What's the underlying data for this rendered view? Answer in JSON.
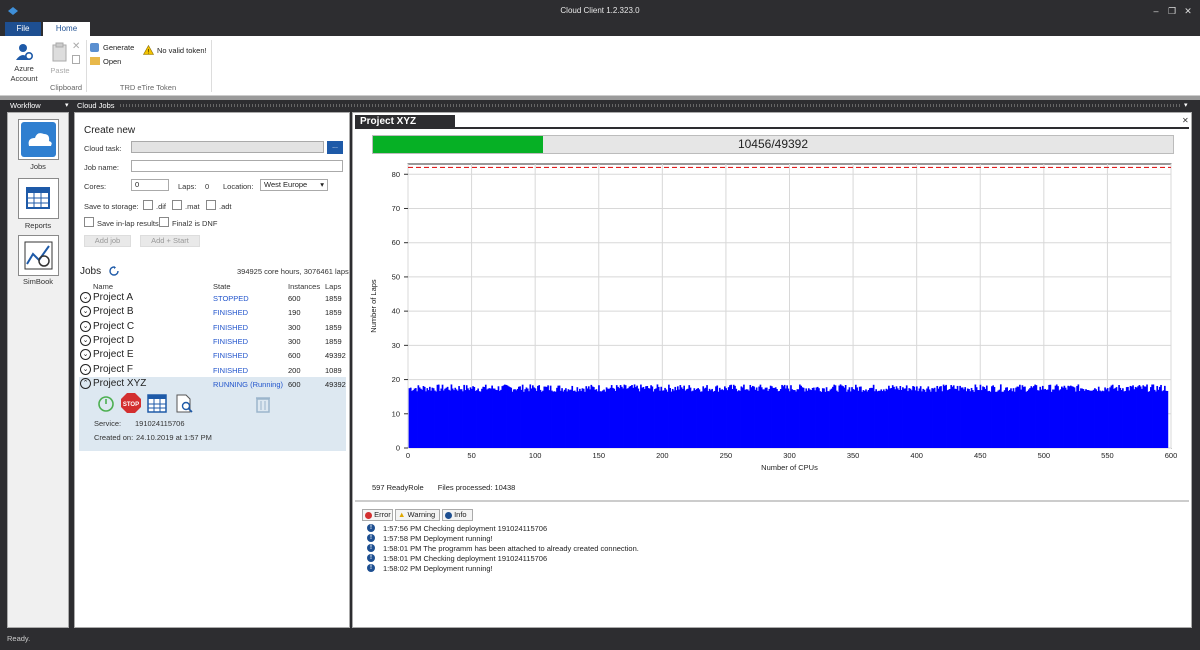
{
  "window": {
    "title": "Cloud Client 1.2.323.0"
  },
  "ribbon": {
    "tabs": [
      "File",
      "Home"
    ],
    "azure_account": "Azure Account",
    "paste": "Paste",
    "clipboard_group": "Clipboard",
    "generate": "Generate",
    "open": "Open",
    "token_warning": "No valid token!",
    "token_group": "TRD eTire Token"
  },
  "workflow": {
    "title": "Workflow",
    "items": [
      {
        "label": "Jobs"
      },
      {
        "label": "Reports"
      },
      {
        "label": "SimBook"
      }
    ]
  },
  "cloud_jobs": {
    "title": "Cloud Jobs",
    "create_new": "Create new",
    "cloud_task_label": "Cloud task:",
    "browse_label": "...",
    "job_name_label": "Job name:",
    "cores_label": "Cores:",
    "cores_value": "0",
    "laps_label": "Laps:",
    "laps_value": "0",
    "location_label": "Location:",
    "location_value": "West Europe",
    "save_label": "Save to storage:",
    "dif": ".dif",
    "mat": ".mat",
    "adt": ".adt",
    "save_inlap": "Save in-lap results",
    "final2": "Final2 is DNF",
    "add_job": "Add job",
    "add_start": "Add + Start",
    "jobs_title": "Jobs",
    "summary": "394925 core hours, 3076461 laps",
    "columns": [
      "Name",
      "State",
      "Instances",
      "Laps"
    ],
    "rows": [
      {
        "name": "Project A",
        "state": "STOPPED",
        "instances": "600",
        "laps": "1859"
      },
      {
        "name": "Project B",
        "state": "FINISHED",
        "instances": "190",
        "laps": "1859"
      },
      {
        "name": "Project C",
        "state": "FINISHED",
        "instances": "300",
        "laps": "1859"
      },
      {
        "name": "Project D",
        "state": "FINISHED",
        "instances": "300",
        "laps": "1859"
      },
      {
        "name": "Project E",
        "state": "FINISHED",
        "instances": "600",
        "laps": "49392"
      },
      {
        "name": "Project F",
        "state": "FINISHED",
        "instances": "200",
        "laps": "1089"
      },
      {
        "name": "Project XYZ",
        "state": "RUNNING (Running)",
        "instances": "600",
        "laps": "49392"
      }
    ],
    "service_label": "Service:",
    "service_value": "191024115706",
    "created_label": "Created on:",
    "created_value": "24.10.2019 at 1:57 PM"
  },
  "project": {
    "tab": "Project XYZ",
    "progress_text": "10456/49392",
    "progress_fraction": 0.212,
    "ready_role": "597 ReadyRole",
    "files_processed": "Files processed: 10438"
  },
  "chart_data": {
    "type": "bar",
    "xlabel": "Number of CPUs",
    "ylabel": "Number of Laps",
    "xlim": [
      0,
      600
    ],
    "ylim": [
      0,
      83
    ],
    "xticks": [
      "0",
      "50",
      "100",
      "150",
      "200",
      "250",
      "300",
      "350",
      "400",
      "450",
      "500",
      "550",
      "600"
    ],
    "yticks": [
      "0",
      "10",
      "20",
      "30",
      "40",
      "50",
      "60",
      "70",
      "80"
    ],
    "bar_count": 597,
    "typical_value": 17.5,
    "target_line": 82,
    "grid": true,
    "colors": {
      "bars": "#0000ff",
      "target": "#e02020"
    }
  },
  "log": {
    "filters": [
      "Error",
      "Warning",
      "Info"
    ],
    "entries": [
      "1:57:56 PM Checking deployment 191024115706",
      "1:57:58 PM Deployment running!",
      "1:58:01 PM The programm has been attached to already created connection.",
      "1:58:01 PM Checking deployment 191024115706",
      "1:58:02 PM Deployment running!"
    ]
  },
  "statusbar": {
    "text": "Ready."
  }
}
